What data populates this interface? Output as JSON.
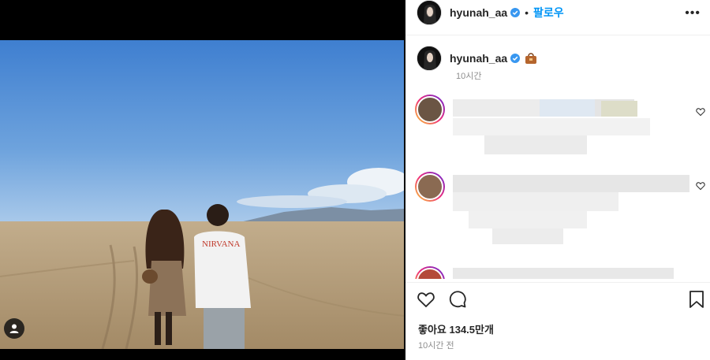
{
  "post": {
    "username": "hyunah_aa",
    "follow_label": "팔로우",
    "separator": "•",
    "more_label": "•••"
  },
  "caption": {
    "username": "hyunah_aa",
    "time": "10시간"
  },
  "footer": {
    "likes_label": "좋아요 134.5만개",
    "time_ago": "10시간 전"
  },
  "colors": {
    "follow": "#0095f6",
    "verified": "#3897f0",
    "text": "#262626",
    "muted": "#8e8e8e"
  },
  "icons": [
    "verified-badge-icon",
    "more-options-icon",
    "heart-icon",
    "comment-icon",
    "bookmark-icon",
    "user-tag-icon",
    "shopping-bag-icon"
  ]
}
